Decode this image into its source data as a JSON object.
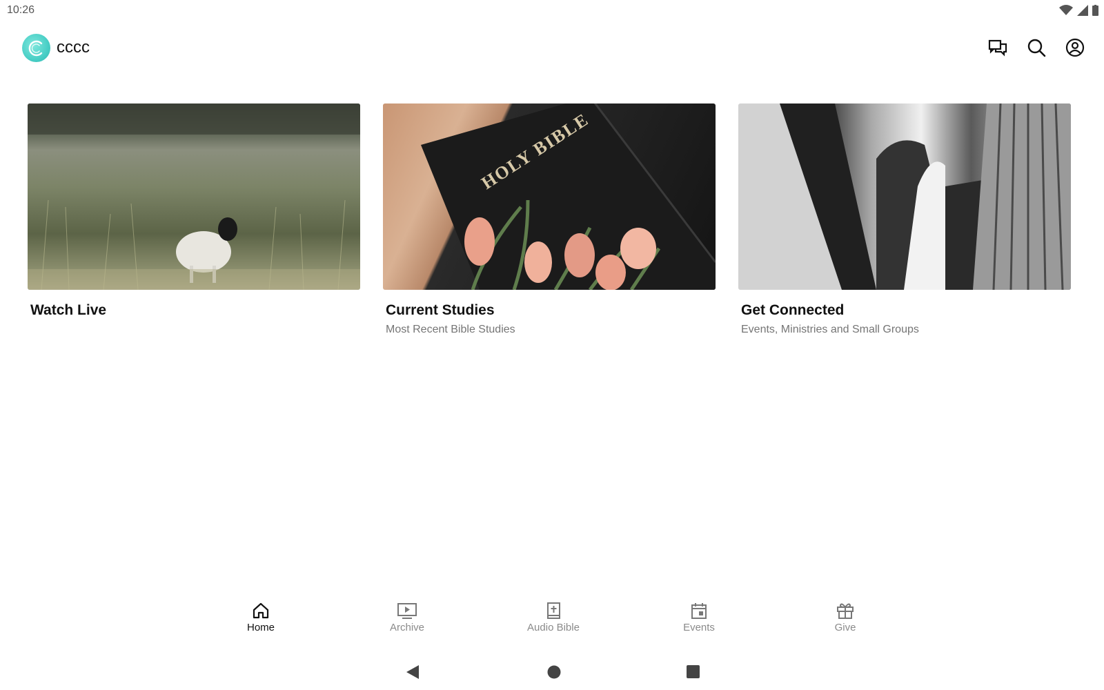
{
  "status_bar": {
    "time": "10:26",
    "icons": [
      "wifi-icon",
      "cellular-icon",
      "battery-icon"
    ]
  },
  "app_bar": {
    "title": "cccc",
    "logo": "cccc-logo",
    "actions": [
      "chat-icon",
      "search-icon",
      "account-icon"
    ]
  },
  "cards": [
    {
      "title": "Watch Live",
      "subtitle": "",
      "image": "lamb-in-field"
    },
    {
      "title": "Current Studies",
      "subtitle": "Most Recent Bible Studies",
      "image": "holy-bible-with-tulips",
      "image_text": "HOLY BIBLE"
    },
    {
      "title": "Get Connected",
      "subtitle": "Events, Ministries and Small Groups",
      "image": "clasped-hands"
    }
  ],
  "bottom_nav": {
    "items": [
      {
        "label": "Home",
        "icon": "home-icon",
        "active": true
      },
      {
        "label": "Archive",
        "icon": "archive-play-icon",
        "active": false
      },
      {
        "label": "Audio Bible",
        "icon": "bible-icon",
        "active": false
      },
      {
        "label": "Events",
        "icon": "calendar-icon",
        "active": false
      },
      {
        "label": "Give",
        "icon": "gift-icon",
        "active": false
      }
    ]
  },
  "system_nav": [
    "back-button",
    "home-button",
    "recents-button"
  ],
  "colors": {
    "accent_logo": "#49cfc6",
    "text_primary": "#111111",
    "text_secondary": "#757575",
    "nav_inactive": "#8a8a8a"
  }
}
